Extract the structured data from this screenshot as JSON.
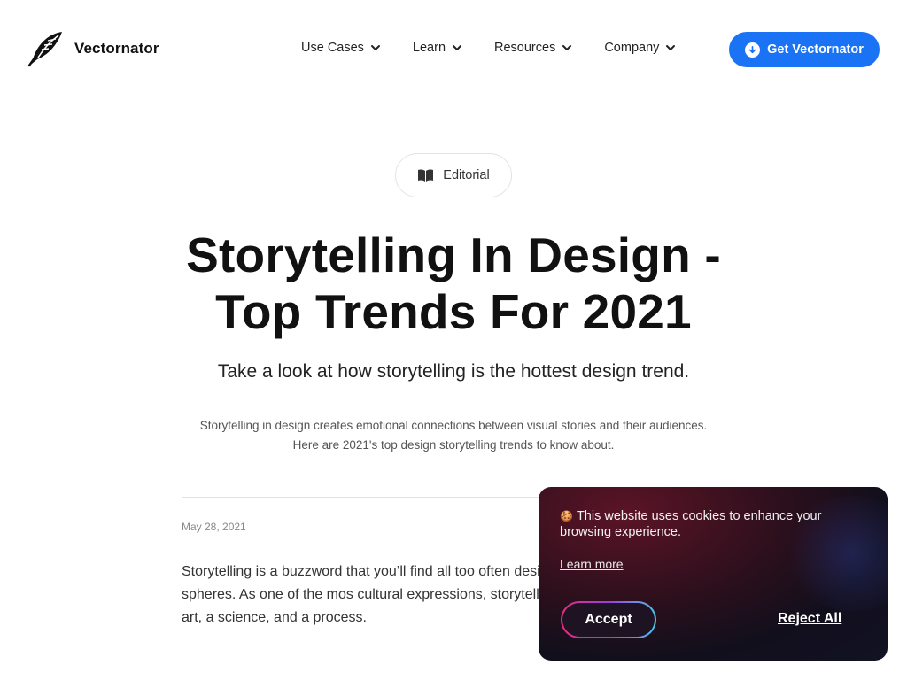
{
  "header": {
    "brand": "Vectornator",
    "nav": [
      {
        "label": "Use Cases"
      },
      {
        "label": "Learn"
      },
      {
        "label": "Resources"
      },
      {
        "label": "Company"
      }
    ],
    "cta_label": "Get Vectornator",
    "accent_color": "#1a73f5"
  },
  "article": {
    "category": "Editorial",
    "category_icon": "book-icon",
    "title": "Storytelling In Design - Top Trends For 2021",
    "subtitle": "Take a look at how storytelling is the hottest design trend.",
    "lead": "Storytelling in design creates emotional connections between visual stories and their audiences. Here are 2021's top design storytelling trends to know about.",
    "date": "May 28, 2021",
    "body": "Storytelling is a buzzword that you’ll find all too often design, UX, and marketing spheres. As one of the mos cultural expressions, storytelling is applicable across i an art, a science, and a process."
  },
  "cookie_banner": {
    "emoji": "🍪",
    "message": "This website uses cookies to enhance your browsing experience.",
    "learn_more": "Learn more",
    "accept_label": "Accept",
    "reject_label": "Reject All"
  }
}
